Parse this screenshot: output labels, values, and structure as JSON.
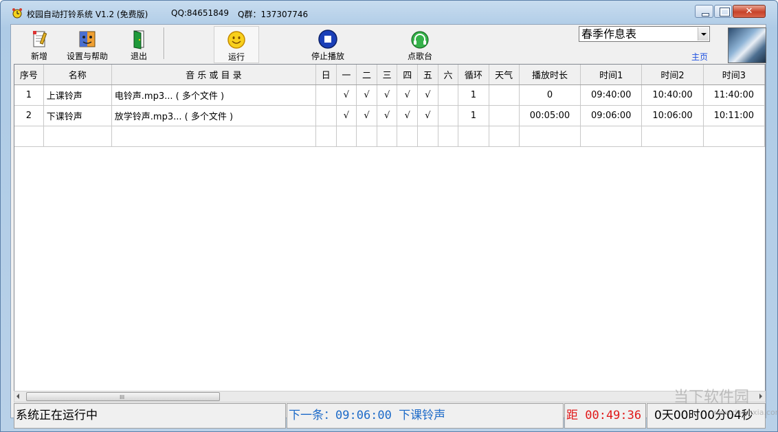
{
  "window": {
    "title": "校园自动打铃系统 V1.2 (免费版)",
    "qq": "QQ:84651849",
    "qgroup": "Q群：137307746"
  },
  "toolbar": {
    "new_label": "新增",
    "settings_label": "设置与帮助",
    "exit_label": "退出",
    "run_label": "运行",
    "stop_label": "停止播放",
    "song_label": "点歌台",
    "schedule_value": "春季作息表",
    "home_link": "主页"
  },
  "table": {
    "headers": [
      "序号",
      "名称",
      "音 乐 或 目 录",
      "日",
      "一",
      "二",
      "三",
      "四",
      "五",
      "六",
      "循环",
      "天气",
      "播放时长",
      "时间1",
      "时间2",
      "时间3"
    ],
    "rows": [
      [
        "1",
        "上课铃声",
        "电铃声.mp3... ( 多个文件 )",
        "",
        "√",
        "√",
        "√",
        "√",
        "√",
        "",
        "1",
        "",
        "0",
        "09:40:00",
        "10:40:00",
        "11:40:00"
      ],
      [
        "2",
        "下课铃声",
        "放学铃声.mp3... ( 多个文件 )",
        "",
        "√",
        "√",
        "√",
        "√",
        "√",
        "",
        "1",
        "",
        "00:05:00",
        "09:06:00",
        "10:06:00",
        "10:11:00"
      ],
      [
        "",
        "",
        "",
        "",
        "",
        "",
        "",
        "",
        "",
        "",
        "",
        "",
        "",
        "",
        "",
        ""
      ]
    ]
  },
  "scrollbar": {
    "grip": "III"
  },
  "status": {
    "state": "系统正在运行中",
    "next": "下一条：09:06:00  下课铃声",
    "countdown": "距 00:49:36",
    "days": "0天00时00分04秒"
  },
  "watermark": {
    "text": "当下软件园",
    "url": "www.downxia.com"
  }
}
